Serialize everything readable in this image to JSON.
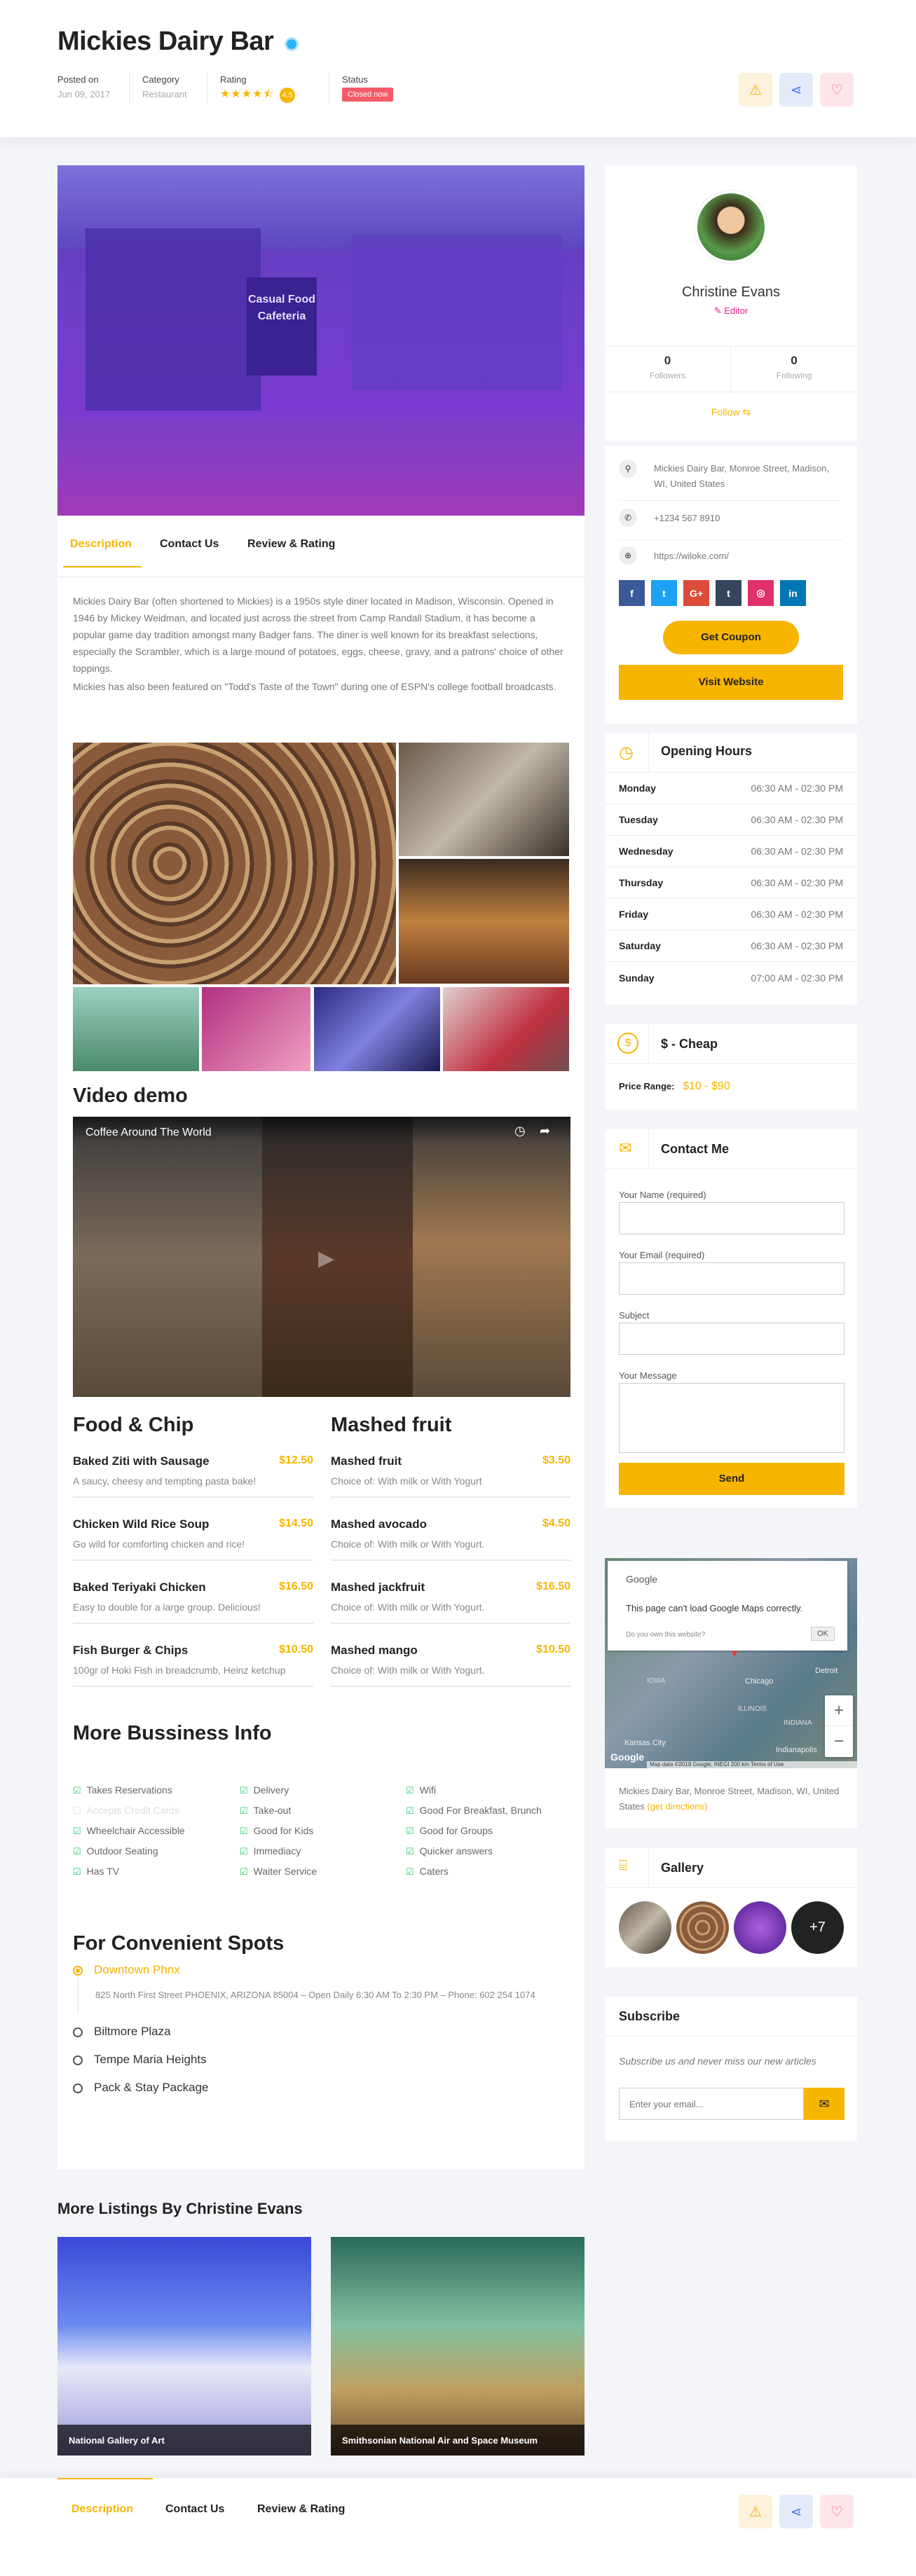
{
  "listing": {
    "title": "Mickies Dairy Bar",
    "posted_label": "Posted on",
    "posted_value": "Jun 09, 2017",
    "category_label": "Category",
    "category_value": "Restaurant",
    "rating_label": "Rating",
    "rating_stars": "★★★★⯪",
    "rating_value": "4.5",
    "status_label": "Status",
    "status_value": "Closed now"
  },
  "hero": {
    "sign_text": "Casual Food Cafeteria"
  },
  "tabs": [
    "Description",
    "Contact Us",
    "Review & Rating"
  ],
  "description": {
    "p1": "Mickies Dairy Bar (often shortened to Mickies) is a 1950s style diner located in Madison, Wisconsin. Opened in 1946 by Mickey Weidman, and located just across the street from Camp Randall Stadium, it has become a popular game day tradition amongst many Badger fans. The diner is well known for its breakfast selections, especially the Scrambler, which is a large mound of potatoes, eggs, cheese, gravy, and a patrons' choice of other toppings.",
    "p2": "Mickies has also been featured on \"Todd's Taste of the Town\" during one of ESPN's college football broadcasts."
  },
  "video": {
    "heading": "Video demo",
    "title": "Coffee Around The World"
  },
  "menus": [
    {
      "heading": "Food & Chip",
      "items": [
        {
          "name": "Baked Ziti with Sausage",
          "price": "$12.50",
          "desc": "A saucy, cheesy and tempting pasta bake!"
        },
        {
          "name": "Chicken Wild Rice Soup",
          "price": "$14.50",
          "desc": "Go wild for comforting chicken and rice!"
        },
        {
          "name": "Baked Teriyaki Chicken",
          "price": "$16.50",
          "desc": "Easy to double for a large group. Delicious!"
        },
        {
          "name": "Fish Burger & Chips",
          "price": "$10.50",
          "desc": "100gr of Hoki Fish in breadcrumb, Heinz ketchup"
        }
      ]
    },
    {
      "heading": "Mashed fruit",
      "items": [
        {
          "name": "Mashed fruit",
          "price": "$3.50",
          "desc": "Choice of: With milk or With Yogurt"
        },
        {
          "name": "Mashed avocado",
          "price": "$4.50",
          "desc": "Choice of: With milk or With Yogurt."
        },
        {
          "name": "Mashed jackfruit",
          "price": "$16.50",
          "desc": "Choice of: With milk or With Yogurt."
        },
        {
          "name": "Mashed mango",
          "price": "$10.50",
          "desc": "Choice of: With milk or With Yogurt."
        }
      ]
    }
  ],
  "business": {
    "heading": "More Bussiness Info",
    "columns": [
      [
        {
          "label": "Takes Reservations",
          "on": true
        },
        {
          "label": "Accepts Credit Cards",
          "on": false
        },
        {
          "label": "Wheelchair Accessible",
          "on": true
        },
        {
          "label": "Outdoor Seating",
          "on": true
        },
        {
          "label": "Has TV",
          "on": true
        }
      ],
      [
        {
          "label": "Delivery",
          "on": true
        },
        {
          "label": "Take-out",
          "on": true
        },
        {
          "label": "Good for Kids",
          "on": true
        },
        {
          "label": "Immediacy",
          "on": true
        },
        {
          "label": "Waiter Service",
          "on": true
        }
      ],
      [
        {
          "label": "Wifi",
          "on": true
        },
        {
          "label": "Good For Breakfast, Brunch",
          "on": true
        },
        {
          "label": "Good for Groups",
          "on": true
        },
        {
          "label": "Quicker answers",
          "on": true
        },
        {
          "label": "Caters",
          "on": true
        }
      ]
    ]
  },
  "spots": {
    "heading": "For Convenient Spots",
    "active": "Downtown Phnx",
    "active_detail": "825 North First Street PHOENIX, ARIZONA 85004 – Open Daily 6:30 AM To 2:30 PM – Phone: 602 254 1074",
    "others": [
      "Biltmore Plaza",
      "Tempe Maria Heights",
      "Pack & Stay Package"
    ]
  },
  "more_listings": {
    "heading": "More Listings By Christine Evans",
    "items": [
      "National Gallery of Art",
      "Smithsonian National Air and Space Museum"
    ]
  },
  "author": {
    "name": "Christine Evans",
    "role": "Editor",
    "followers": "0",
    "followers_label": "Followers",
    "following": "0",
    "following_label": "Following",
    "follow_btn": "Follow"
  },
  "contact_info": {
    "address": "Mickies Dairy Bar, Monroe Street, Madison, WI, United States",
    "phone": "+1234 567 8910",
    "website": "https://wiloke.com/",
    "socials": [
      "f",
      "t",
      "G+",
      "t",
      "◎",
      "in"
    ],
    "coupon_btn": "Get Coupon",
    "visit_btn": "Visit Website"
  },
  "hours": {
    "heading": "Opening Hours",
    "rows": [
      {
        "day": "Monday",
        "time": "06:30 AM - 02:30 PM"
      },
      {
        "day": "Tuesday",
        "time": "06:30 AM - 02:30 PM"
      },
      {
        "day": "Wednesday",
        "time": "06:30 AM - 02:30 PM"
      },
      {
        "day": "Thursday",
        "time": "06:30 AM - 02:30 PM"
      },
      {
        "day": "Friday",
        "time": "06:30 AM - 02:30 PM"
      },
      {
        "day": "Saturday",
        "time": "06:30 AM - 02:30 PM"
      },
      {
        "day": "Sunday",
        "time": "07:00 AM - 02:30 PM"
      }
    ]
  },
  "price": {
    "heading": "$ - Cheap",
    "label": "Price Range:",
    "value": "$10 - $90"
  },
  "contact_form": {
    "heading": "Contact Me",
    "name_label": "Your Name (required)",
    "email_label": "Your Email (required)",
    "subject_label": "Subject",
    "message_label": "Your Message",
    "send": "Send"
  },
  "map": {
    "google": "Google",
    "error": "This page can't load Google Maps correctly.",
    "own": "Do you own this website?",
    "ok": "OK",
    "address": "Mickies Dairy Bar, Monroe Street, Madison, WI, United States",
    "directions": "(get directions)",
    "zoom_in": "+",
    "zoom_out": "−",
    "city_labels": [
      "IOWA",
      "ILLINOIS",
      "INDIANA",
      "Chicago",
      "Detroit",
      "Kansas City",
      "Indianapolis"
    ],
    "footer": "Map data ©2018 Google, INEGI   200 km       Terms of Use"
  },
  "gallery": {
    "heading": "Gallery",
    "more": "+7"
  },
  "subscribe": {
    "heading": "Subscribe",
    "text": "Subscribe us and never miss our new articles",
    "placeholder": "Enter your email..."
  },
  "colors": {
    "accent": "#f7b500",
    "danger": "#f45b69",
    "success": "#2ecc71"
  }
}
